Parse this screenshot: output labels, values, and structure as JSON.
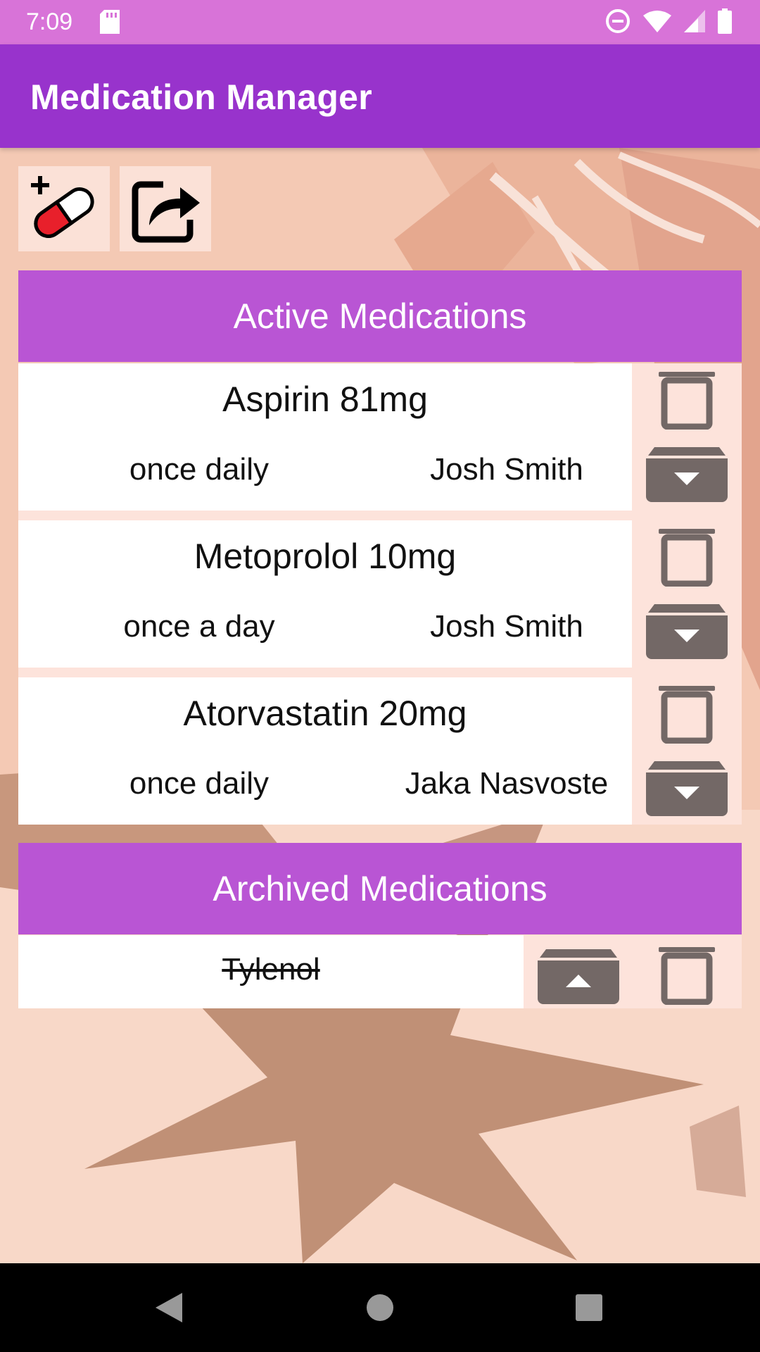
{
  "status_bar": {
    "time": "7:09",
    "icons": [
      "sd-card-icon",
      "do-not-disturb-icon",
      "wifi-icon",
      "signal-icon",
      "battery-icon"
    ]
  },
  "app_bar": {
    "title": "Medication Manager"
  },
  "toolbar": {
    "add_medication_icon": "pill-plus-icon",
    "share_icon": "share-icon"
  },
  "active_section": {
    "title": "Active Medications",
    "medications": [
      {
        "name": "Aspirin 81mg",
        "frequency": "once daily",
        "prescriber": "Josh Smith"
      },
      {
        "name": "Metoprolol 10mg",
        "frequency": "once a day",
        "prescriber": "Josh Smith"
      },
      {
        "name": "Atorvastatin 20mg",
        "frequency": "once daily",
        "prescriber": "Jaka Nasvoste"
      }
    ]
  },
  "archived_section": {
    "title": "Archived Medications",
    "medications": [
      {
        "name": "Tylenol"
      }
    ]
  },
  "colors": {
    "status_bar": "#d873d8",
    "app_bar": "#9833cc",
    "section_header": "#b955d4",
    "action_background": "#fde3db",
    "icon_gray": "#736866",
    "pill_red": "#e8202b"
  },
  "nav_bar": {
    "buttons": [
      "back-icon",
      "home-icon",
      "recents-icon"
    ]
  }
}
